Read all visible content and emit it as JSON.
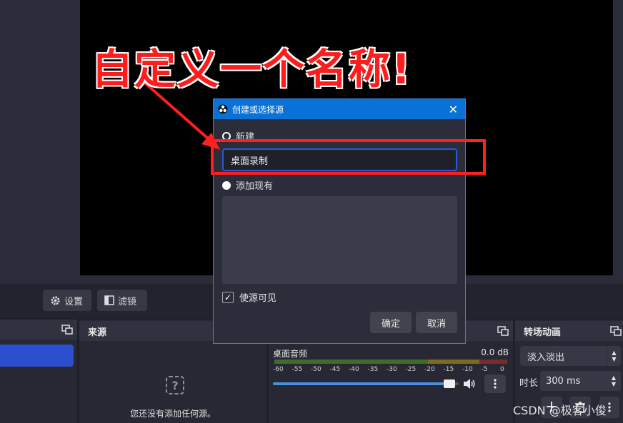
{
  "annotation": {
    "text": "自定义一个名称!"
  },
  "toolbar": {
    "settings_label": "设置",
    "filters_label": "滤镜"
  },
  "sources_dock": {
    "title": "来源",
    "empty_text": "您还没有添加任何源。"
  },
  "mixer": {
    "track_name": "桌面音频",
    "level": "0.0 dB",
    "ticks": [
      "-60",
      "-55",
      "-50",
      "-45",
      "-40",
      "-35",
      "-30",
      "-25",
      "-20",
      "-15",
      "-10",
      "-5",
      "0"
    ],
    "volume": 0.98
  },
  "transitions": {
    "title": "转场动画",
    "selected": "淡入淡出",
    "duration_label": "时长",
    "duration_value": "300 ms"
  },
  "dialog": {
    "title": "创建或选择源",
    "new_label": "新建",
    "name_value": "桌面录制",
    "existing_label": "添加现有",
    "visible_label": "使源可见",
    "ok_label": "确定",
    "cancel_label": "取消"
  },
  "watermark": "CSDN @极客小俊"
}
